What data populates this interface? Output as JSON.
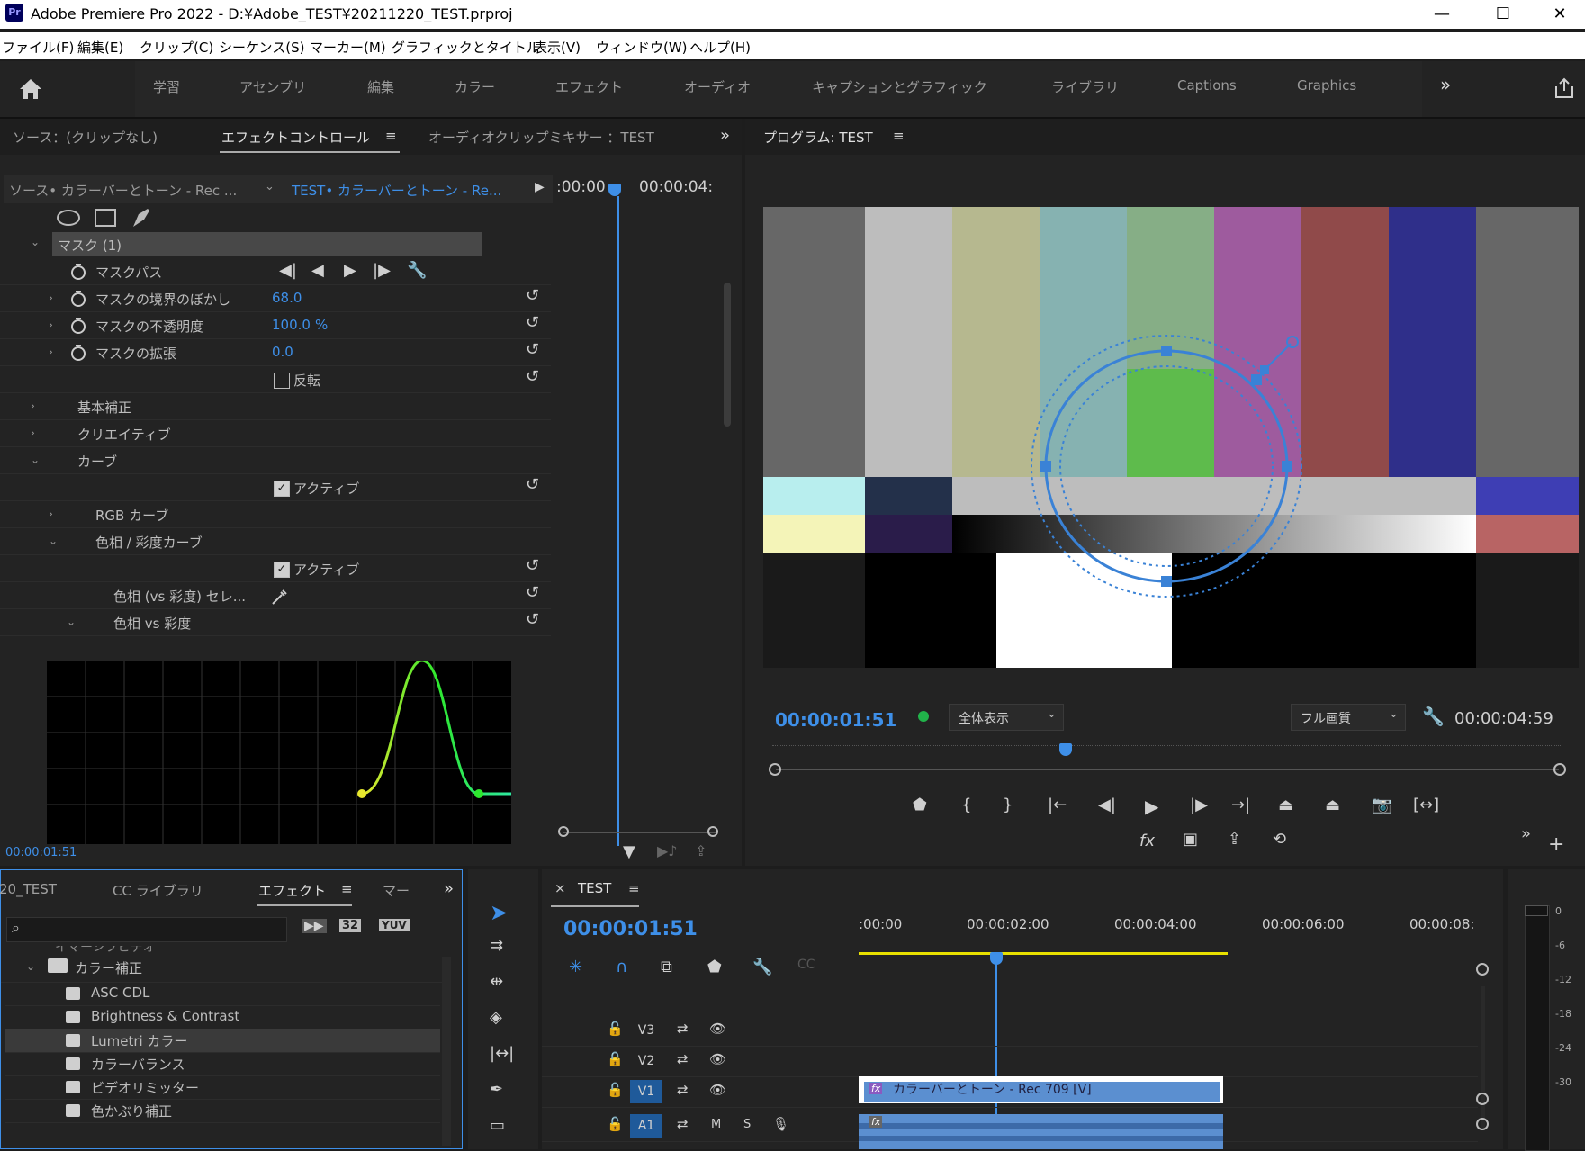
{
  "window": {
    "title": "Adobe Premiere Pro 2022 - D:¥Adobe_TEST¥20211220_TEST.prproj",
    "logo": "Pr",
    "minimize": "—",
    "maximize": "☐",
    "close": "✕"
  },
  "menu": [
    "ファイル(F)",
    "編集(E)",
    "クリップ(C)",
    "シーケンス(S)",
    "マーカー(M)",
    "グラフィックとタイトル",
    "表示(V)",
    "ウィンドウ(W)",
    "ヘルプ(H)"
  ],
  "workspaces": [
    "学習",
    "アセンブリ",
    "編集",
    "カラー",
    "エフェクト",
    "オーディオ",
    "キャプションとグラフィック",
    "ライブラリ",
    "Captions",
    "Graphics"
  ],
  "workspace_more": "»",
  "effect_controls": {
    "tabs": [
      "ソース：(クリップなし)",
      "エフェクトコントロール",
      "オーディオクリップミキサー ：TEST"
    ],
    "active_tab": "エフェクトコントロール",
    "tab_menu": "≡",
    "more": "»",
    "source_clip": "ソース• カラーバーとトーン - Rec ...",
    "sequence_clip": "TEST• カラーバーとトーン - Re...",
    "time_start": ":00:00",
    "time_end": "00:00:04:",
    "mask_header": "マスク (1)",
    "properties": [
      {
        "label": "マスクパス",
        "value": ""
      },
      {
        "label": "マスクの境界のぼかし",
        "value": "68.0"
      },
      {
        "label": "マスクの不透明度",
        "value": "100.0",
        "unit": "%"
      },
      {
        "label": "マスクの拡張",
        "value": "0.0"
      }
    ],
    "invert_label": "反転",
    "sections": [
      "基本補正",
      "クリエイティブ",
      "カーブ"
    ],
    "active_label": "アクティブ",
    "rgb_curve": "RGB カーブ",
    "hue_sat_curve": "色相 / 彩度カーブ",
    "hue_selector": "色相 (vs 彩度) セレ...",
    "hue_vs_sat": "色相 vs 彩度",
    "current_time": "00:00:01:51"
  },
  "program": {
    "title": "プログラム: TEST",
    "menu": "≡",
    "timecode": "00:00:01:51",
    "zoom": "全体表示",
    "quality": "フル画質",
    "duration": "00:00:04:59",
    "playhead_fraction": 0.37
  },
  "project_panel": {
    "tabs": [
      "20_TEST",
      "CC ライブラリ",
      "エフェクト",
      "マー"
    ],
    "active_tab": "エフェクト",
    "search_placeholder": "",
    "badges": [
      "32",
      "YUV"
    ],
    "folder_partial": "イマーシブビデオ",
    "folder": "カラー補正",
    "items": [
      "ASC CDL",
      "Brightness & Contrast",
      "Lumetri カラー",
      "カラーバランス",
      "ビデオリミッター",
      "色かぶり補正"
    ],
    "selected_item": "Lumetri カラー"
  },
  "timeline": {
    "title": "TEST",
    "close": "×",
    "menu": "≡",
    "timecode": "00:00:01:51",
    "ruler": [
      ":00:00",
      "00:00:02:00",
      "00:00:04:00",
      "00:00:06:00",
      "00:00:08:"
    ],
    "tracks": [
      {
        "name": "V3",
        "active": false
      },
      {
        "name": "V2",
        "active": false
      },
      {
        "name": "V1",
        "active": true
      },
      {
        "name": "A1",
        "active": true
      }
    ],
    "clip_label": "カラーバーとトーン - Rec 709 [V]",
    "audio_mute": "M",
    "audio_solo": "S"
  },
  "meter": {
    "labels": [
      "0",
      "-6",
      "-12",
      "-18",
      "-24",
      "-30"
    ]
  },
  "colors": {
    "accent": "#3e8fe8",
    "curve_green": "#2ee82e",
    "curve_yellow": "#e8e82e",
    "clip_blue": "#5b8fd0",
    "work_area": "#e8e000"
  }
}
